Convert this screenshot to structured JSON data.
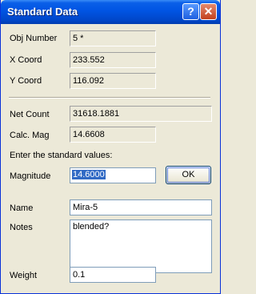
{
  "window": {
    "title": "Standard Data"
  },
  "info": {
    "obj_number_label": "Obj Number",
    "obj_number": "5 *",
    "x_coord_label": "X Coord",
    "x_coord": "233.552",
    "y_coord_label": "Y Coord",
    "y_coord": "116.092",
    "net_count_label": "Net Count",
    "net_count": "31618.1881",
    "calc_mag_label": "Calc. Mag",
    "calc_mag": "14.6608"
  },
  "form": {
    "prompt": "Enter the standard values:",
    "magnitude_label": "Magnitude",
    "magnitude": "14.6000",
    "ok_label": "OK",
    "name_label": "Name",
    "name": "Mira-5",
    "notes_label": "Notes",
    "notes": "blended?",
    "weight_label": "Weight",
    "weight": "0.1"
  },
  "icons": {
    "help": "help-icon",
    "close": "close-icon"
  }
}
